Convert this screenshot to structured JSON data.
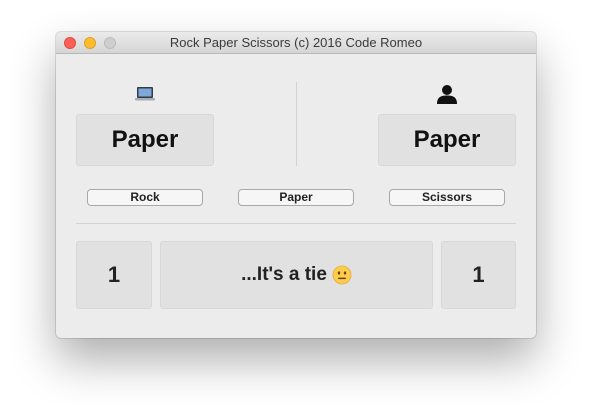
{
  "window": {
    "title": "Rock Paper Scissors (c) 2016 Code Romeo"
  },
  "computer": {
    "icon": "laptop-icon",
    "choice": "Paper"
  },
  "player": {
    "icon": "user-icon",
    "choice": "Paper"
  },
  "buttons": {
    "rock": "Rock",
    "paper": "Paper",
    "scissors": "Scissors"
  },
  "scoreboard": {
    "computer_score": "1",
    "result_text": "...It's a tie",
    "result_icon": "neutral-face-emoji",
    "player_score": "1"
  }
}
